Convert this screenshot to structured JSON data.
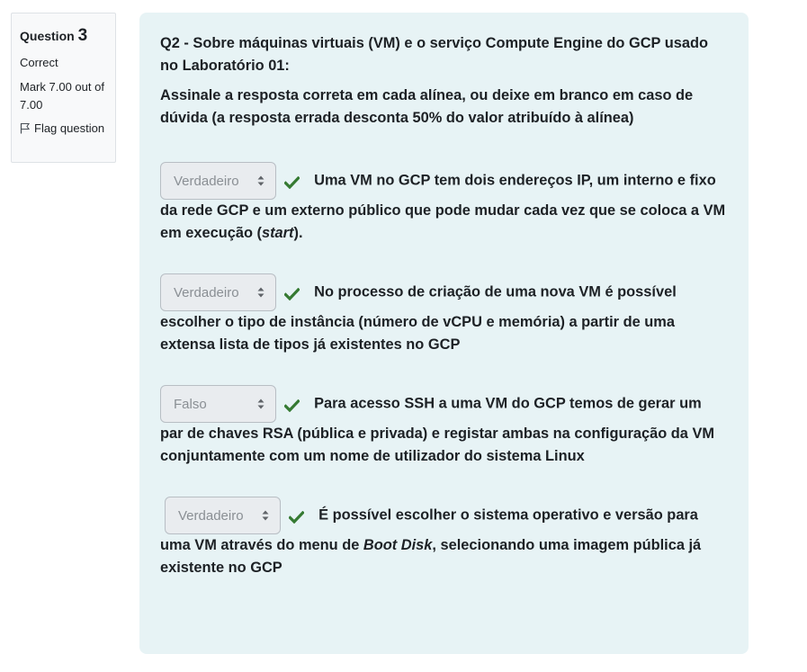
{
  "info": {
    "question_label": "Question",
    "question_number": "3",
    "state": "Correct",
    "grade": "Mark 7.00 out of 7.00",
    "flag_label": "Flag question"
  },
  "question": {
    "title": "Q2 - Sobre máquinas virtuais (VM) e o serviço Compute Engine do GCP usado no Laboratório 01:",
    "instructions": "Assinale a resposta correta em cada alínea, ou deixe em branco em caso de dúvida (a resposta errada desconta 50% do valor atribuído à alínea)",
    "items": [
      {
        "selected": "Verdadeiro",
        "text_a": "Uma VM no GCP tem dois endereços IP, um interno e fixo da rede GCP e um externo público que pode mudar cada vez que se coloca a VM em execução (",
        "text_em": "start",
        "text_b": ")."
      },
      {
        "selected": "Verdadeiro",
        "text_a": "No processo de criação de uma nova VM é possível escolher o tipo de instância (número de vCPU e memória) a partir de uma extensa lista de tipos já existentes no GCP"
      },
      {
        "selected": "Falso",
        "text_a": "Para acesso SSH a uma VM do GCP temos de gerar um par de chaves RSA (pública e privada) e registar ambas na configuração da VM conjuntamente com um nome de utilizador do sistema Linux"
      },
      {
        "selected": "Verdadeiro",
        "text_a": "É possível escolher o sistema operativo e versão  para uma VM através do menu de ",
        "text_em": "Boot Disk",
        "text_b": ", selecionando uma imagem pública já existente no GCP"
      }
    ]
  },
  "colors": {
    "formulation_bg": "#e7f3f5",
    "check_green": "#357a32",
    "select_bg": "#e9ecef"
  },
  "icons": {
    "correct": "check-icon",
    "flag": "flag-icon",
    "select_arrows": "sort-arrows-icon"
  }
}
